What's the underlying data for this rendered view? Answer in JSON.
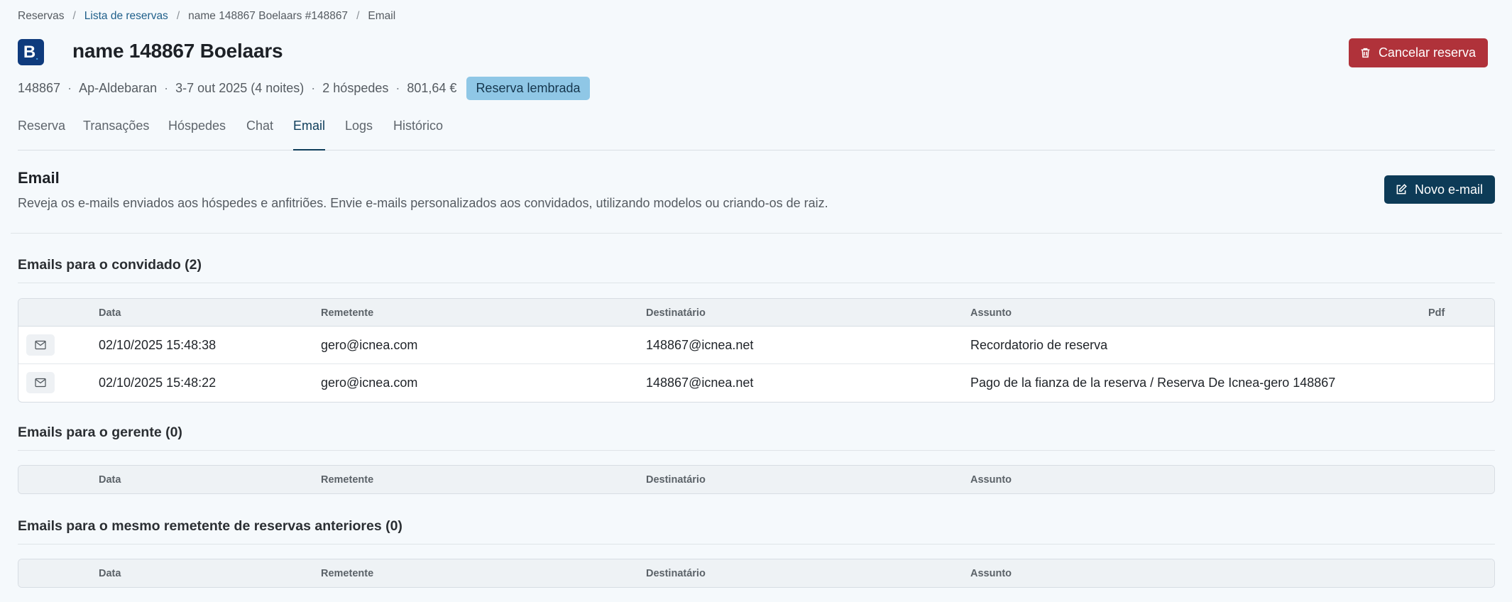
{
  "breadcrumb": {
    "items": [
      "Reservas",
      "Lista de reservas",
      "name 148867 Boelaars #148867",
      "Email"
    ]
  },
  "header": {
    "logo_letter": "B",
    "logo_dot": ".",
    "title": "name 148867 Boelaars",
    "cancel_label": "Cancelar reserva",
    "meta": {
      "id": "148867",
      "apartment": "Ap-Aldebaran",
      "dates": "3-7 out 2025 (4 noites)",
      "guests": "2 hóspedes",
      "price": "801,64 €",
      "badge": "Reserva lembrada"
    }
  },
  "tabs": [
    {
      "label": "Reserva"
    },
    {
      "label": "Transações"
    },
    {
      "label": "Hóspedes"
    },
    {
      "label": "Chat"
    },
    {
      "label": "Email"
    },
    {
      "label": "Logs"
    },
    {
      "label": "Histórico"
    }
  ],
  "active_tab": "Email",
  "section": {
    "title": "Email",
    "description": "Reveja os e-mails enviados aos hóspedes e anfitriões. Envie e-mails personalizados aos convidados, utilizando modelos ou criando-os de raiz.",
    "new_email_label": "Novo e-mail"
  },
  "columns": {
    "date": "Data",
    "from": "Remetente",
    "to": "Destinatário",
    "subject": "Assunto",
    "pdf": "Pdf"
  },
  "groups": {
    "guest": {
      "title": "Emails para o convidado (2)",
      "rows": [
        {
          "date": "02/10/2025 15:48:38",
          "from": "gero@icnea.com",
          "to": "148867@icnea.net",
          "subject": "Recordatorio de reserva"
        },
        {
          "date": "02/10/2025 15:48:22",
          "from": "gero@icnea.com",
          "to": "148867@icnea.net",
          "subject": "Pago de la fianza de la reserva / Reserva De Icnea-gero 148867"
        }
      ]
    },
    "manager": {
      "title": "Emails para o gerente (0)"
    },
    "previous": {
      "title": "Emails para o mesmo remetente de reservas anteriores (0)"
    }
  },
  "colors": {
    "background": "#f5f9fc",
    "primary": "#0d3b57",
    "danger": "#b0323a",
    "badge": "#8fc7e6",
    "brand": "#0f3b7d"
  }
}
